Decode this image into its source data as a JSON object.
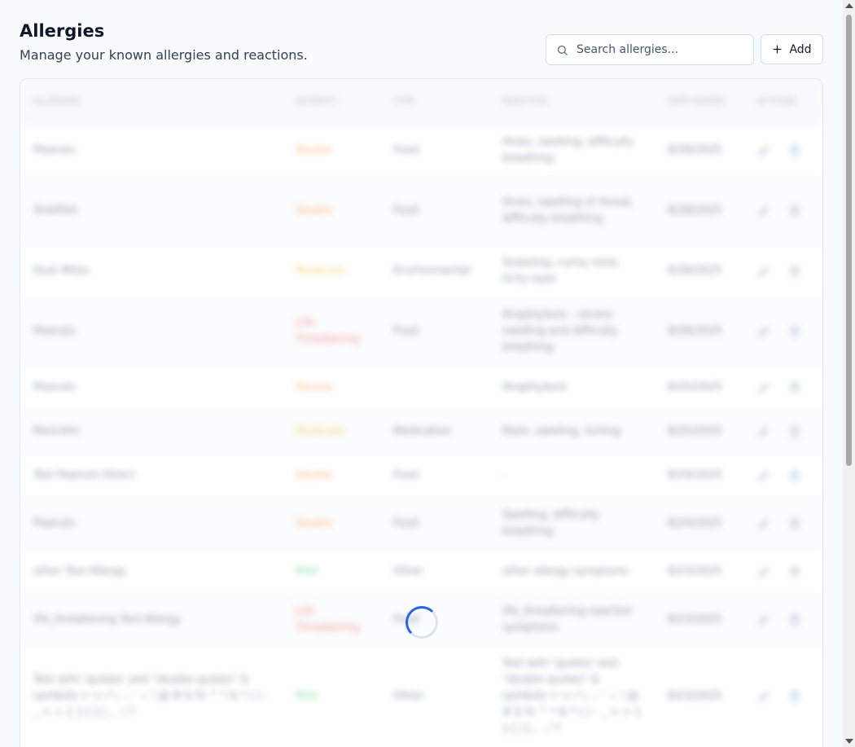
{
  "header": {
    "title": "Allergies",
    "subtitle": "Manage your known allergies and reactions.",
    "search_placeholder": "Search allergies...",
    "add_label": "Add"
  },
  "table": {
    "columns": [
      "Allergen",
      "Severity",
      "Type",
      "Reaction",
      "Date Added",
      "Actions"
    ],
    "rows": [
      {
        "allergen": "Peanuts",
        "severity": "Severe",
        "sev_class": "sev-severe",
        "type": "Food",
        "reaction": "Hives, swelling, difficulty breathing",
        "date": "8/28/2025",
        "h": 64
      },
      {
        "allergen": "Shellfish",
        "severity": "Severe",
        "sev_class": "sev-severe",
        "type": "Food",
        "reaction": "Hives, swelling of throat, difficulty breathing",
        "date": "8/28/2025",
        "h": 84
      },
      {
        "allergen": "Dust Mites",
        "severity": "Moderate",
        "sev_class": "sev-moderate",
        "type": "Environmental",
        "reaction": "Sneezing, runny nose, itchy eyes",
        "date": "8/28/2025",
        "h": 64
      },
      {
        "allergen": "Peanuts",
        "severity": "Life Threatening",
        "sev_class": "sev-life",
        "type": "Food",
        "reaction": "Anaphylaxis - severe swelling and difficulty breathing",
        "date": "8/28/2025",
        "h": 84
      },
      {
        "allergen": "Peanuts",
        "severity": "Severe",
        "sev_class": "sev-severe",
        "type": "",
        "reaction": "Anaphylaxis",
        "date": "8/25/2025",
        "h": 54
      },
      {
        "allergen": "Penicillin",
        "severity": "Moderate",
        "sev_class": "sev-moderate",
        "type": "Medication",
        "reaction": "Rash, swelling, itching",
        "date": "8/25/2025",
        "h": 54
      },
      {
        "allergen": "Test Peanuts Direct",
        "severity": "Severe",
        "sev_class": "sev-severe",
        "type": "Food",
        "reaction": "-",
        "date": "8/24/2025",
        "h": 54
      },
      {
        "allergen": "Peanuts",
        "severity": "Severe",
        "sev_class": "sev-severe",
        "type": "Food",
        "reaction": "Swelling, difficulty breathing",
        "date": "8/24/2025",
        "h": 64
      },
      {
        "allergen": "other Test Allergy",
        "severity": "Mild",
        "sev_class": "sev-mild",
        "type": "Other",
        "reaction": "other allergy symptoms",
        "date": "8/23/2025",
        "h": 54
      },
      {
        "allergen": "life_threatening Test Allergy",
        "severity": "Life Threatening",
        "sev_class": "sev-life",
        "type": "Food",
        "reaction": "life_threatening reaction symptoms",
        "date": "8/23/2025",
        "h": 64
      },
      {
        "allergen": "Test with 'quotes' and \"double quotes\" & symbols < > / \\ ; : ' ~ ! @ # $ % ^ * & * ( ) - _ = + { } [ ] | , . / ?",
        "severity": "Mild",
        "sev_class": "sev-mild",
        "type": "Other",
        "reaction": "Test with 'quotes' and \"double quotes\" & symbols < > / \\ ; : ' ~ ! @ # $ % ^ * & * ( ) - _ = + { } [ ] | , . / ?",
        "date": "8/23/2025",
        "h": 124
      }
    ]
  }
}
